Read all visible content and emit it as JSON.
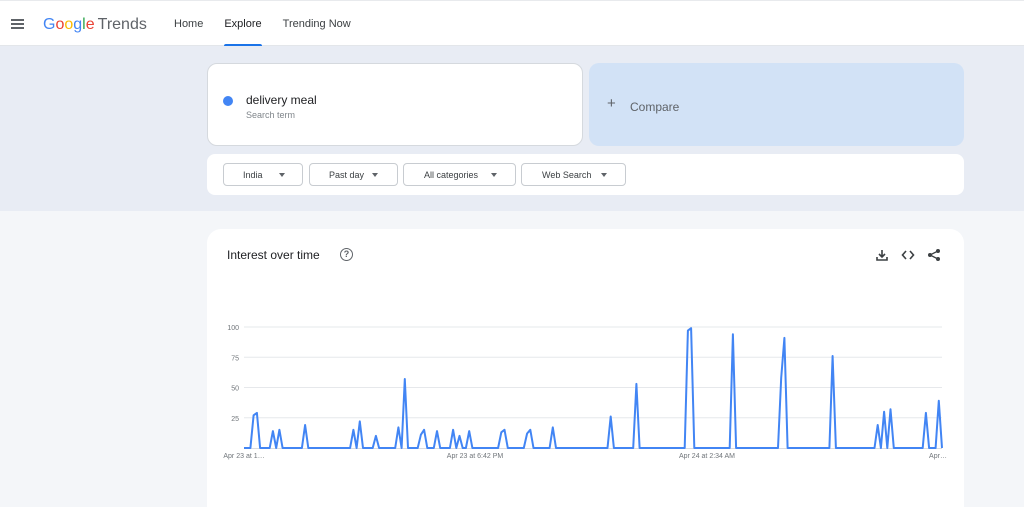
{
  "header": {
    "logo": {
      "google": [
        "G",
        "o",
        "o",
        "g",
        "l",
        "e"
      ],
      "product": "Trends"
    },
    "nav": [
      {
        "label": "Home",
        "active": false
      },
      {
        "label": "Explore",
        "active": true
      },
      {
        "label": "Trending Now",
        "active": false
      }
    ]
  },
  "search_term": {
    "name": "delivery meal",
    "subtitle": "Search term",
    "color": "#4285f4"
  },
  "compare": {
    "label": "Compare",
    "icon": "plus-icon"
  },
  "filters": [
    {
      "label": "India",
      "name": "location"
    },
    {
      "label": "Past day",
      "name": "time-range"
    },
    {
      "label": "All categories",
      "name": "category"
    },
    {
      "label": "Web Search",
      "name": "search-type"
    }
  ],
  "chart_section": {
    "title": "Interest over time",
    "icons": [
      "help-icon",
      "download-icon",
      "embed-icon",
      "share-icon"
    ]
  },
  "chart_data": {
    "type": "line",
    "title": "Interest over time",
    "ylim": [
      0,
      100
    ],
    "yticks": [
      25,
      50,
      75,
      100
    ],
    "xtick_labels": [
      "Apr 23 at 1…",
      "Apr 23 at 6:42 PM",
      "Apr 24 at 2:34 AM",
      "Apr…"
    ],
    "grid": true,
    "series": [
      {
        "color": "#4285f4",
        "values": [
          0,
          0,
          0,
          27,
          29,
          0,
          0,
          0,
          0,
          14,
          0,
          15,
          0,
          0,
          0,
          0,
          0,
          0,
          0,
          19,
          0,
          0,
          0,
          0,
          0,
          0,
          0,
          0,
          0,
          0,
          0,
          0,
          0,
          0,
          15,
          0,
          22,
          0,
          0,
          0,
          0,
          10,
          0,
          0,
          0,
          0,
          0,
          0,
          17,
          0,
          57,
          0,
          0,
          0,
          0,
          11,
          15,
          0,
          0,
          0,
          14,
          0,
          0,
          0,
          0,
          15,
          0,
          10,
          0,
          0,
          14,
          0,
          0,
          0,
          0,
          0,
          0,
          0,
          0,
          0,
          13,
          15,
          0,
          0,
          0,
          0,
          0,
          0,
          12,
          15,
          0,
          0,
          0,
          0,
          0,
          0,
          17,
          0,
          0,
          0,
          0,
          0,
          0,
          0,
          0,
          0,
          0,
          0,
          0,
          0,
          0,
          0,
          0,
          0,
          26,
          0,
          0,
          0,
          0,
          0,
          0,
          0,
          53,
          0,
          0,
          0,
          0,
          0,
          0,
          0,
          0,
          0,
          0,
          0,
          0,
          0,
          0,
          0,
          97,
          99,
          0,
          0,
          0,
          0,
          0,
          0,
          0,
          0,
          0,
          0,
          0,
          0,
          94,
          0,
          0,
          0,
          0,
          0,
          0,
          0,
          0,
          0,
          0,
          0,
          0,
          0,
          0,
          58,
          91,
          0,
          0,
          0,
          0,
          0,
          0,
          0,
          0,
          0,
          0,
          0,
          0,
          0,
          0,
          76,
          0,
          0,
          0,
          0,
          0,
          0,
          0,
          0,
          0,
          0,
          0,
          0,
          0,
          19,
          0,
          30,
          0,
          32,
          0,
          0,
          0,
          0,
          0,
          0,
          0,
          0,
          0,
          0,
          29,
          0,
          0,
          0,
          39,
          0
        ]
      }
    ]
  }
}
